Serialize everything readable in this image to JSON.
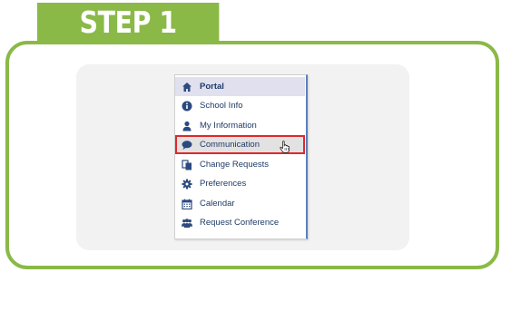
{
  "step": {
    "label": "STEP 1"
  },
  "menu": {
    "items": [
      {
        "label": "Portal",
        "icon": "home-icon",
        "state": "active"
      },
      {
        "label": "School Info",
        "icon": "info-circle-icon"
      },
      {
        "label": "My Information",
        "icon": "user-icon"
      },
      {
        "label": "Communication",
        "icon": "speech-bubble-icon",
        "state": "highlighted"
      },
      {
        "label": "Change Requests",
        "icon": "documents-icon"
      },
      {
        "label": "Preferences",
        "icon": "gear-icon"
      },
      {
        "label": "Calendar",
        "icon": "calendar-icon"
      },
      {
        "label": "Request Conference",
        "icon": "users-group-icon"
      }
    ]
  },
  "colors": {
    "accent_green": "#8ab947",
    "menu_text": "#1f3a67",
    "icon_blue": "#2b4a7f",
    "highlight_border": "#e0282b",
    "active_bg": "#e1e0ef"
  }
}
